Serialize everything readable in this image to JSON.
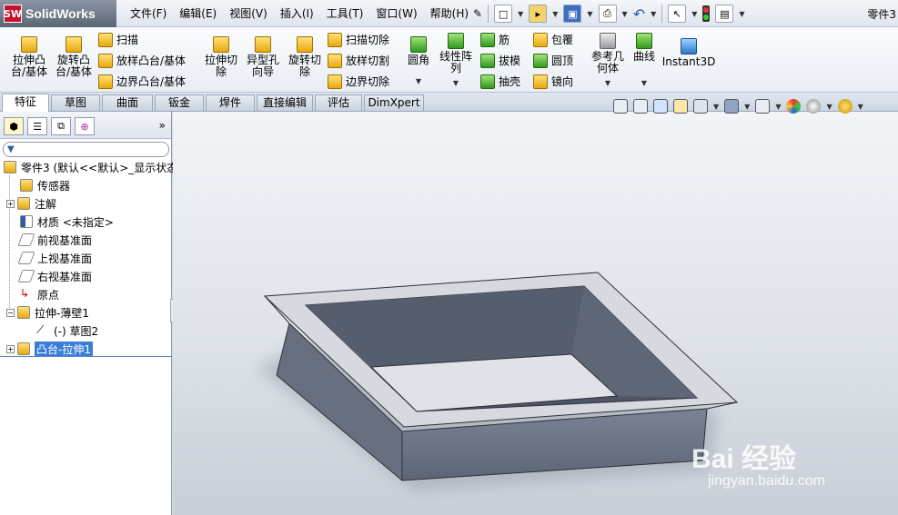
{
  "app": {
    "brand": "SolidWorks",
    "logo_mark": "SW",
    "doc_title": "零件3"
  },
  "menu": [
    "文件(F)",
    "编辑(E)",
    "视图(V)",
    "插入(I)",
    "工具(T)",
    "窗口(W)",
    "帮助(H)"
  ],
  "quick_access": [
    "pin-icon",
    "new-document-icon",
    "open-icon",
    "save-icon",
    "print-icon",
    "undo-icon",
    "select-pointer-icon",
    "rebuild-traffic-light-icon",
    "options-icon"
  ],
  "commands": {
    "extrude_boss": "拉伸凸\n台/基体",
    "revolve_boss": "旋转凸\n台/基体",
    "sweep": "扫描",
    "loft_boss": "放样凸台/基体",
    "boundary_boss": "边界凸台/基体",
    "extrude_cut": "拉伸切\n除",
    "hole_wizard": "异型孔\n向导",
    "revolve_cut": "旋转切\n除",
    "sweep_cut": "扫描切除",
    "loft_cut": "放样切割",
    "boundary_cut": "边界切除",
    "fillet": "圆角",
    "linear_pattern": "线性阵\n列",
    "rib": "筋",
    "draft": "拔模",
    "shell": "抽壳",
    "wrap": "包覆",
    "dome": "圆顶",
    "mirror": "镜向",
    "ref_geometry": "参考几\n何体",
    "curves": "曲线",
    "instant3d": "Instant3D"
  },
  "tabs": [
    "特征",
    "草图",
    "曲面",
    "钣金",
    "焊件",
    "直接编辑",
    "评估",
    "DimXpert"
  ],
  "panel": {
    "expand": "»",
    "filter_icon": "filter-icon"
  },
  "tree": [
    {
      "label": "零件3  (默认<<默认>_显示状态",
      "icon": "part-icon"
    },
    {
      "label": "传感器",
      "icon": "sensor-icon"
    },
    {
      "label": "注解",
      "icon": "annotation-icon"
    },
    {
      "label": "材质 <未指定>",
      "icon": "material-icon"
    },
    {
      "label": "前视基准面",
      "icon": "plane-icon"
    },
    {
      "label": "上视基准面",
      "icon": "plane-icon"
    },
    {
      "label": "右视基准面",
      "icon": "plane-icon"
    },
    {
      "label": "原点",
      "icon": "origin-icon"
    },
    {
      "label": "拉伸-薄壁1",
      "icon": "extrude-feature-icon"
    },
    {
      "label": "(-) 草图2",
      "icon": "sketch-icon"
    },
    {
      "label": "凸台-拉伸1",
      "icon": "extrude-feature-icon"
    }
  ],
  "watermark": {
    "brand": "Bai 经验",
    "url": "jingyan.baidu.com"
  },
  "colors": {
    "model_face": "#6f7888",
    "model_top": "#d9dde3",
    "model_inner": "#4b5261",
    "selection": "#3b7ed8"
  }
}
